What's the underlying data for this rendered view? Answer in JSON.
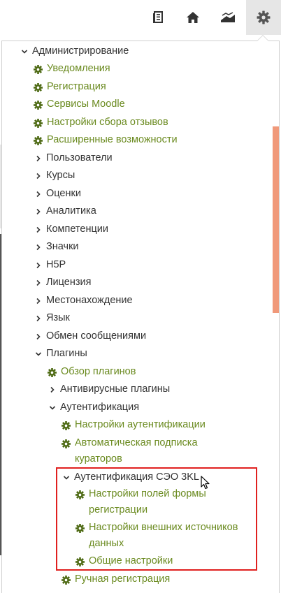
{
  "topbar": {
    "icons": [
      "notes-icon",
      "home-icon",
      "chart-icon",
      "gear-icon"
    ]
  },
  "menu": {
    "admin": "Администрирование",
    "notifications": "Уведомления",
    "registration": "Регистрация",
    "moodle_services": "Сервисы Moodle",
    "feedback_settings": "Настройки сбора отзывов",
    "advanced": "Расширенные возможности",
    "users": "Пользователи",
    "courses": "Курсы",
    "grades": "Оценки",
    "analytics": "Аналитика",
    "competencies": "Компетенции",
    "badges": "Значки",
    "h5p": "H5P",
    "license": "Лицензия",
    "location": "Местонахождение",
    "language": "Язык",
    "messaging": "Обмен сообщениями",
    "plugins": "Плагины",
    "plugins_overview": "Обзор плагинов",
    "antivirus": "Антивирусные плагины",
    "auth": "Аутентификация",
    "auth_settings": "Настройки аутентификации",
    "auto_subscribe": "Автоматическая подписка кураторов",
    "seo_auth": "Аутентификация СЭО 3KL",
    "form_fields": "Настройки полей формы регистрации",
    "external_sources": "Настройки внешних источников данных",
    "general_settings": "Общие настройки",
    "manual_registration": "Ручная регистрация"
  },
  "colors": {
    "link": "#6a8a1f",
    "text": "#333333",
    "highlight": "#e0201f",
    "scrollbar": "#f0997a"
  }
}
